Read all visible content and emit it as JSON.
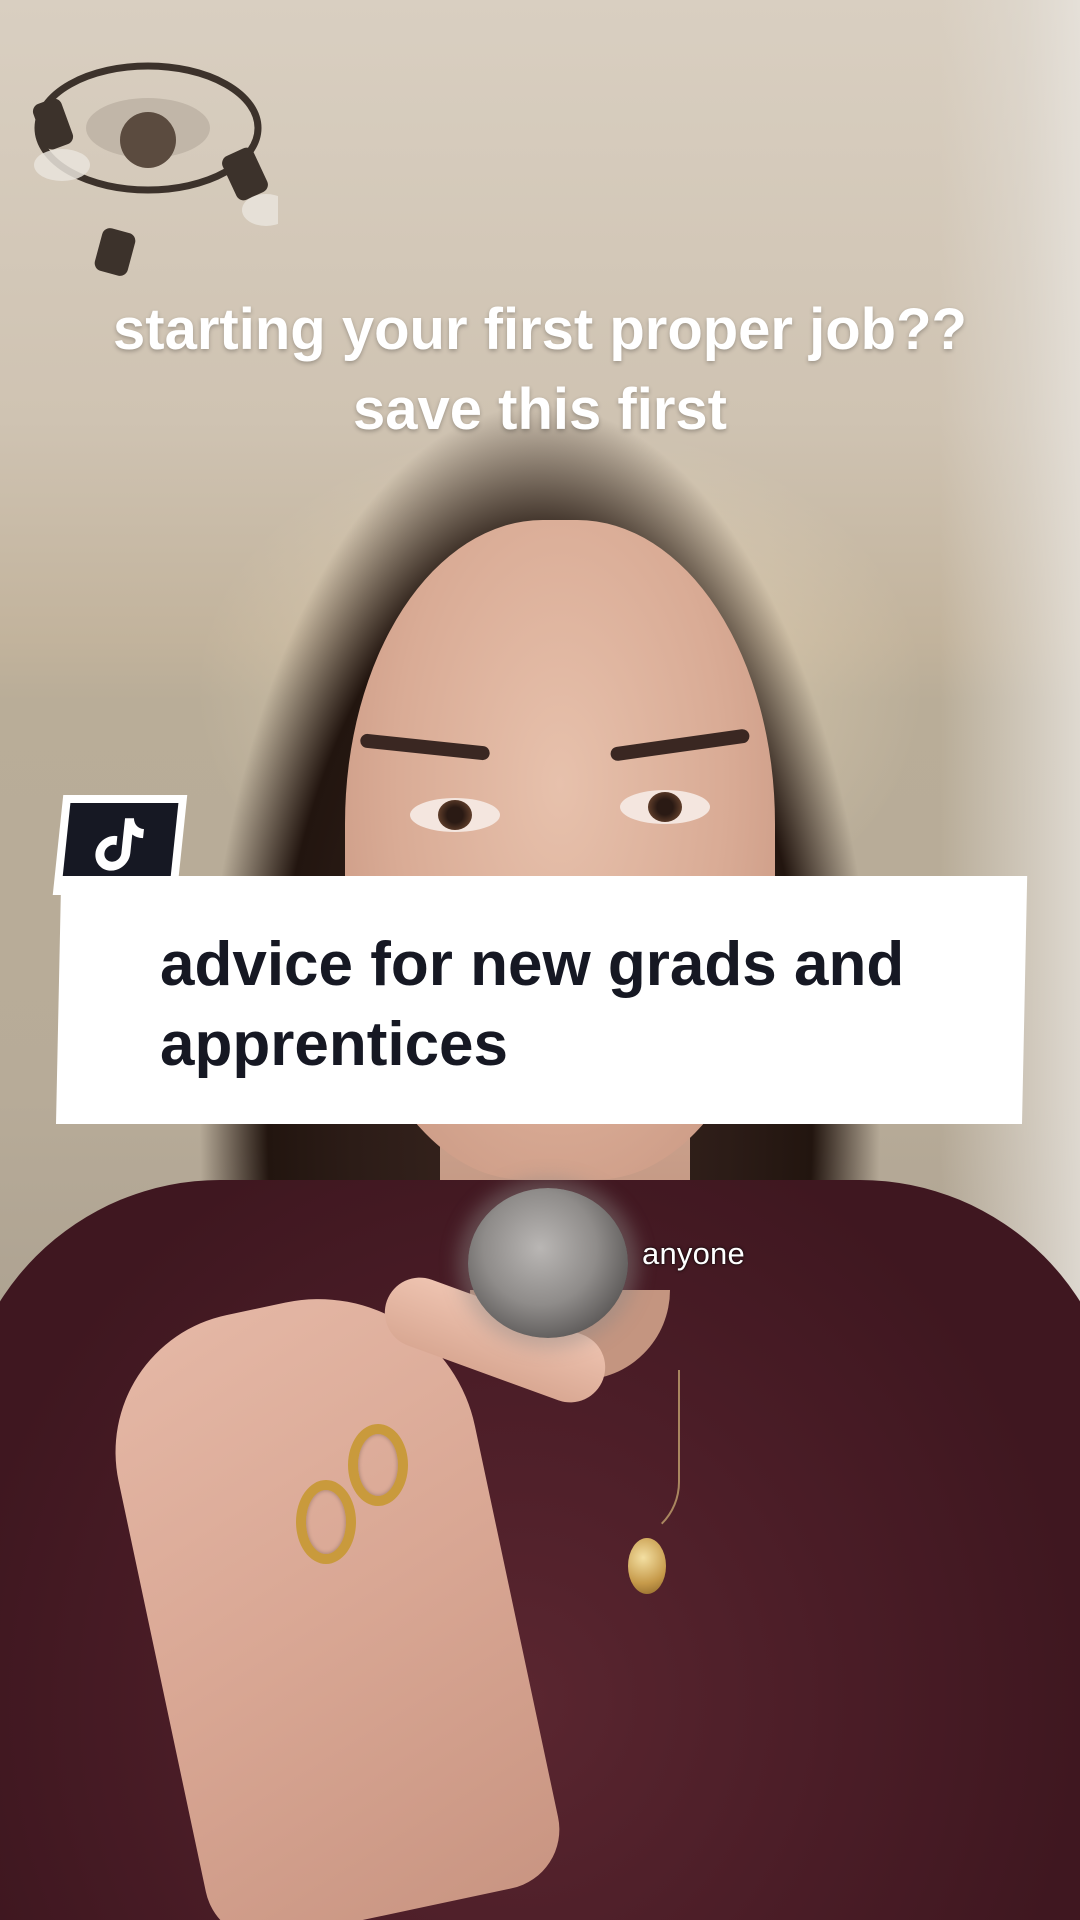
{
  "video": {
    "top_caption_line1": "starting your first proper job??",
    "top_caption_line2": "save this first",
    "title_card_line1": "advice for new grads and",
    "title_card_line2": "apprentices",
    "subtitle": "anyone",
    "badge_icon": "tiktok-logo-icon"
  },
  "colors": {
    "card_bg": "#ffffff",
    "card_text": "#161823",
    "badge_bg": "#161823",
    "caption_text": "#ffffff"
  }
}
